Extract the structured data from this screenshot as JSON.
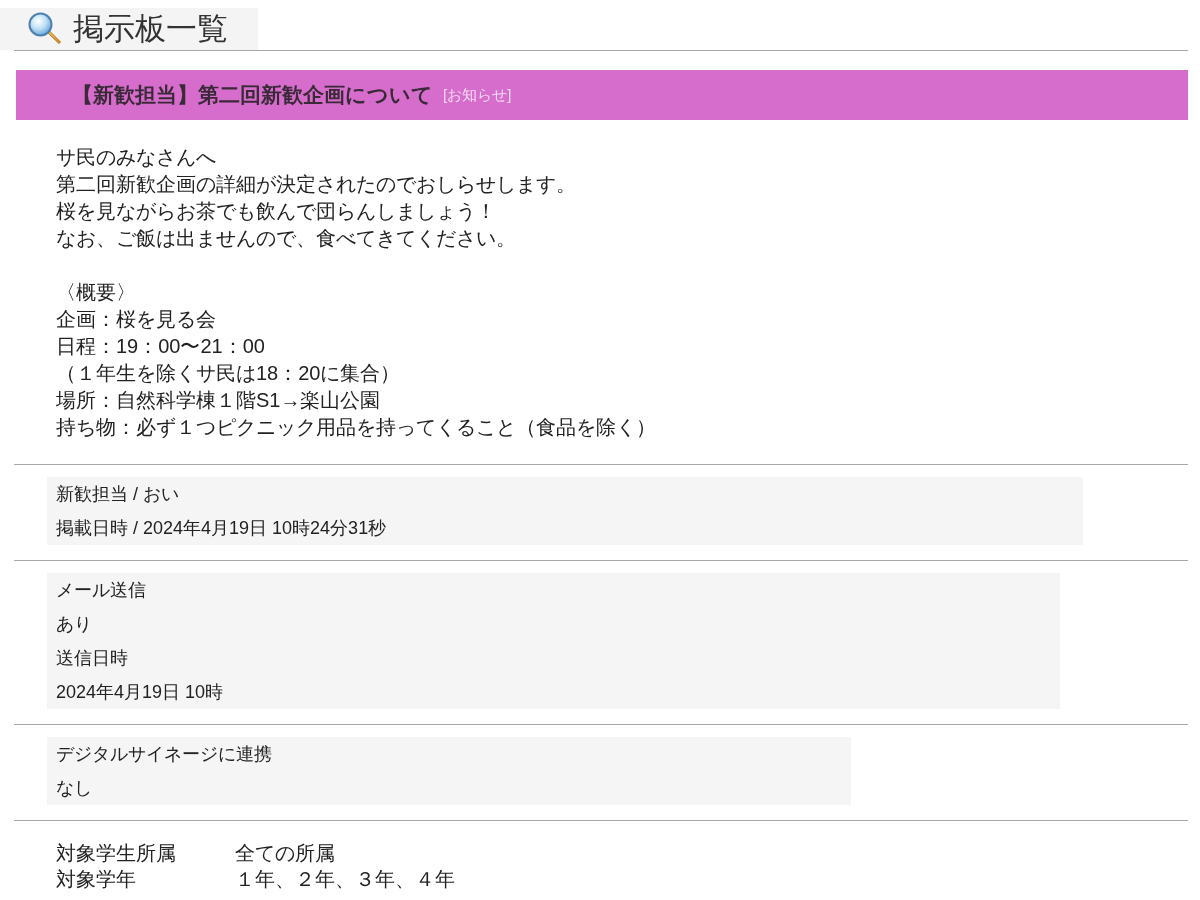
{
  "page_title": "掲示板一覧",
  "notice": {
    "title": "【新歓担当】第二回新歓企画について",
    "category": "[お知らせ]"
  },
  "message": [
    [
      "サ民のみなさんへ",
      "第二回新歓企画の詳細が決定されたのでおしらせします。",
      "桜を見ながらお茶でも飲んで団らんしましょう！",
      "なお、ご飯は出ませんので、食べてきてください。"
    ],
    [
      "〈概要〉",
      "企画：桜を見る会",
      "日程：19：00〜21：00",
      "（１年生を除くサ民は18：20に集合）",
      "場所：自然科学棟１階S1→楽山公園",
      "持ち物：必ず１つピクニック用品を持ってくること（食品を除く）"
    ]
  ],
  "info_panels": [
    {
      "lines": [
        "新歓担当 / おい",
        "掲載日時 / 2024年4月19日 10時24分31秒"
      ]
    },
    {
      "lines": [
        "メール送信",
        "あり",
        "送信日時",
        "2024年4月19日 10時"
      ]
    },
    {
      "lines": [
        "デジタルサイネージに連携",
        "なし"
      ]
    }
  ],
  "targets": [
    {
      "label": "対象学生所属",
      "value": "全ての所属"
    },
    {
      "label": "対象学年",
      "value": "１年、２年、３年、４年"
    }
  ]
}
